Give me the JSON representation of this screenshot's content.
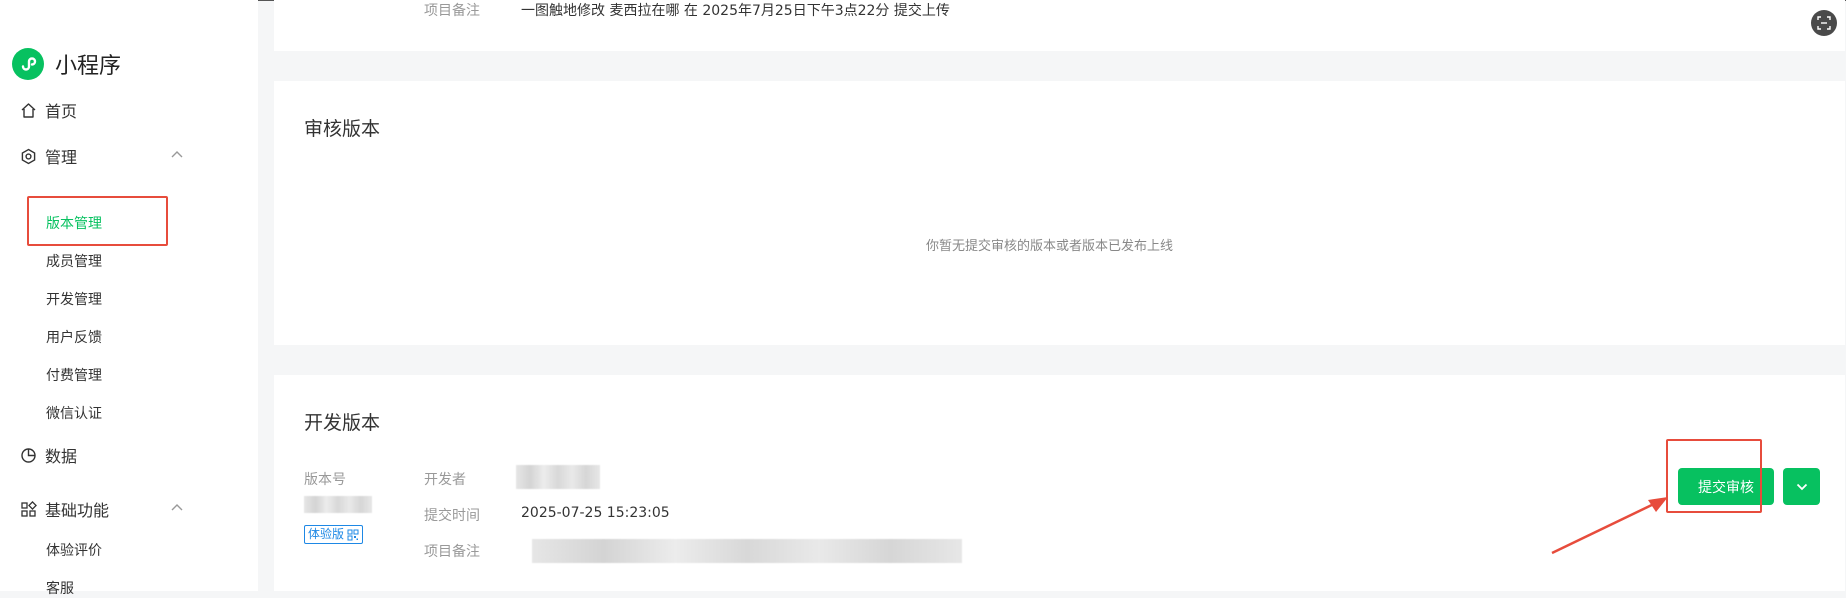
{
  "app": {
    "title": "小程序"
  },
  "sidebar": {
    "home": "首页",
    "manage": {
      "label": "管理",
      "items": [
        "版本管理",
        "成员管理",
        "开发管理",
        "用户反馈",
        "付费管理",
        "微信认证"
      ],
      "active": "版本管理"
    },
    "data": "数据",
    "basic": {
      "label": "基础功能",
      "items": [
        "体验评价",
        "客服"
      ]
    }
  },
  "top_card": {
    "note_label": "项目备注",
    "note_value": "一图触地修改 麦西拉在哪 在 2025年7月25日下午3点22分 提交上传"
  },
  "review_card": {
    "title": "审核版本",
    "empty_text": "你暂无提交审核的版本或者版本已发布上线"
  },
  "dev_card": {
    "title": "开发版本",
    "version_label": "版本号",
    "badge": "体验版",
    "developer_label": "开发者",
    "submit_time_label": "提交时间",
    "submit_time_value": "2025-07-25 15:23:05",
    "note_label": "项目备注",
    "submit_button": "提交审核"
  },
  "colors": {
    "brand": "#07c160",
    "highlight": "#e74c3c",
    "badge": "#1e88e5"
  },
  "icons": [
    "miniprogram-logo-icon",
    "home-icon",
    "settings-hex-icon",
    "chevron-up-icon",
    "pie-chart-icon",
    "grid-icon",
    "chevron-down-icon",
    "qr-icon",
    "scan-icon"
  ]
}
